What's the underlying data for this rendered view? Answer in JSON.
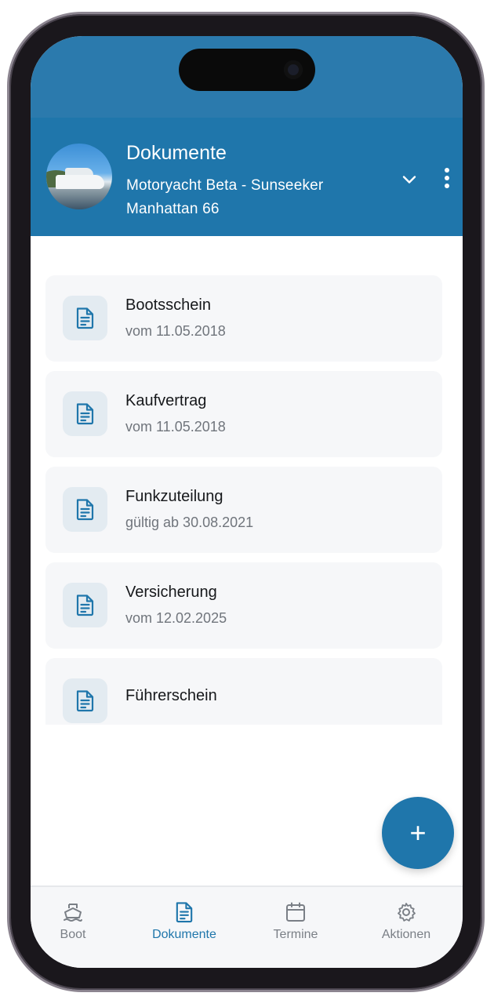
{
  "header": {
    "title": "Dokumente",
    "subtitle_line1": "Motoryacht Beta - Sunseeker",
    "subtitle_line2": "Manhattan 66",
    "avatar_icon": "boat-photo"
  },
  "documents": [
    {
      "title": "Bootsschein",
      "subtitle": "vom 11.05.2018",
      "icon": "document-icon"
    },
    {
      "title": "Kaufvertrag",
      "subtitle": "vom 11.05.2018",
      "icon": "document-icon"
    },
    {
      "title": "Funkzuteilung",
      "subtitle": "gültig ab 30.08.2021",
      "icon": "document-icon"
    },
    {
      "title": "Versicherung",
      "subtitle": "vom 12.02.2025",
      "icon": "document-icon"
    },
    {
      "title": "Führerschein",
      "subtitle": "",
      "icon": "document-icon"
    }
  ],
  "fab": {
    "label": "+"
  },
  "tabs": [
    {
      "label": "Boot",
      "icon": "boat-icon",
      "active": false
    },
    {
      "label": "Dokumente",
      "icon": "document-icon",
      "active": true
    },
    {
      "label": "Termine",
      "icon": "calendar-icon",
      "active": false
    },
    {
      "label": "Aktionen",
      "icon": "gear-icon",
      "active": false
    }
  ],
  "colors": {
    "primary": "#1f76ab",
    "status_bar": "#2b7aad",
    "card_bg": "#f6f7f9",
    "icon_tile_bg": "#e3ebf1",
    "muted_text": "#70757c"
  }
}
